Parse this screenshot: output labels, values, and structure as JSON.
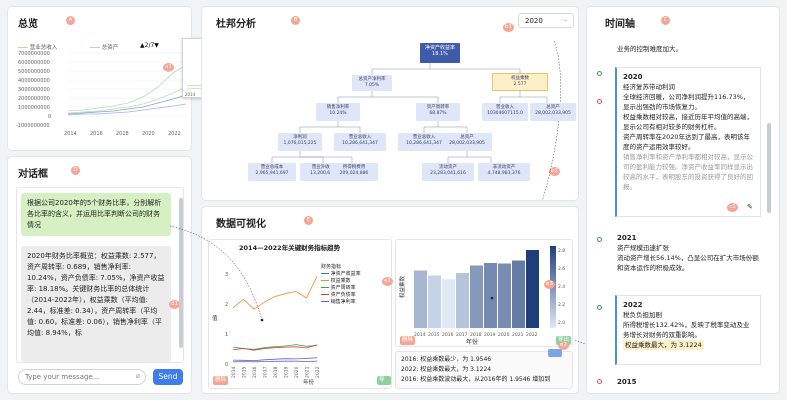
{
  "overview": {
    "title": "总览",
    "badge": "A",
    "legend": [
      "营业总收入",
      "总资产"
    ],
    "legend_pager": "2/7",
    "callout": "a1",
    "yticks": [
      "7000000000",
      "6000000000",
      "5000000000",
      "4000000000",
      "3000000000",
      "2000000000",
      "1000000000",
      "0",
      "-1000000000"
    ],
    "xticks": [
      "2014",
      "2016",
      "2018",
      "2020",
      "2022"
    ],
    "minimap_xticks": [
      "2014",
      "2016",
      "2018",
      "2020",
      "2022"
    ]
  },
  "chat": {
    "title": "对话框",
    "badge": "D",
    "user_message": "根据公司2020年的5个财务比率，分别解析各比率的含义，并运用比率判断公司的财务情况",
    "assistant_message": "2020年财务比率概览：权益乘数: 2.577，资产周转率: 0.689，销售净利率: 10.24%，资产负债率: 7.05%，净资产收益率: 18.18%。关键财务比率的总体统计（2014-2022年），权益乘数（平均值: 2.44，标准差: 0.34），资产周转率（平均值: 0.60，标准差: 0.06），销售净利率（平均值: 8.94%，标",
    "callout": "d1",
    "input_placeholder": "Type your message...",
    "send_label": "Send"
  },
  "dupont": {
    "title": "杜邦分析",
    "badge": "B",
    "year": "2020",
    "callouts": [
      "b1",
      "b2"
    ],
    "nodes": {
      "roe": {
        "label": "净资产收益率",
        "value": "18.1%"
      },
      "roa": {
        "label": "总资产净利率",
        "value": "7.05%"
      },
      "em": {
        "label": "权益乘数",
        "value": "2.577"
      },
      "assets": {
        "label": "总资产",
        "value": "3,077,012,500,000.00"
      },
      "margin": {
        "label": "销售净利率",
        "value": "10.24%"
      },
      "turnover": {
        "label": "资产周转率",
        "value": "68.87%"
      },
      "n1": {
        "label": "营业收入",
        "value": "10304607115.0"
      },
      "n2": {
        "label": "总资产",
        "value": "28,002,033,905"
      },
      "n3": {
        "label": "净利润",
        "value": "1,076,015,225"
      },
      "n4": {
        "label": "营业总收入",
        "value": "10,286,641,347"
      },
      "n5": {
        "label": "营业总收入",
        "value": "10,286,641,347"
      },
      "n6": {
        "label": "总资产",
        "value": "28,002,033,905"
      },
      "n7": {
        "label": "营业总成本",
        "value": "2,965,941,697"
      },
      "n8": {
        "label": "营业外收入",
        "value": "13,200,697"
      },
      "n9": {
        "label": "所得税费用",
        "value": "209,024,886"
      },
      "n10": {
        "label": "流动资产",
        "value": "23,283,041,616"
      },
      "n11": {
        "label": "非流动资产",
        "value": "4,748,983,376"
      }
    }
  },
  "viz": {
    "title": "数据可视化",
    "badge": "E",
    "chips": [
      "e1",
      "e2",
      "e3"
    ],
    "line_chart": {
      "title": "2014—2022年关键财务指标趋势",
      "xlabel": "年份",
      "ylabel": "值",
      "legend_title": "财务指标",
      "legend": [
        "净资产收益率",
        "权益乘数",
        "资产周转率",
        "资产负债率",
        "销售净利率"
      ],
      "legend_colors": [
        "#3d72c9",
        "#f28a2e",
        "#3a9f4c",
        "#d8403a",
        "#8458c1"
      ],
      "xticks": [
        "2014",
        "2015",
        "2016",
        "2017",
        "2018",
        "2019",
        "2020",
        "2021",
        "2022"
      ],
      "yticks": [
        "3",
        "2",
        "1",
        "0"
      ],
      "tags": [
        "删除",
        "导出"
      ]
    },
    "bar_chart": {
      "xlabel": "年份",
      "ylabel": "权益乘数",
      "xticks": [
        "2014",
        "2015",
        "2016",
        "2017",
        "2018",
        "2019",
        "2020",
        "2021",
        "2022"
      ],
      "colorbar_ticks": [
        "2.8",
        "2.6",
        "2.4",
        "2.2",
        "2.0"
      ],
      "tags": [
        "删除",
        "导出"
      ]
    },
    "insights": [
      "2016: 权益乘数最少，为 1.9546",
      "2022: 权益乘数最大，为 3.1224",
      "2016: 权益乘数波动最大，从2016年的 1.9546 增加到"
    ]
  },
  "chart_data": [
    {
      "type": "line",
      "title": "2014—2022年关键财务指标趋势",
      "xlabel": "年份",
      "ylabel": "值",
      "x": [
        2014,
        2015,
        2016,
        2017,
        2018,
        2019,
        2020,
        2021,
        2022
      ],
      "ylim": [
        0,
        3.2
      ],
      "series": [
        {
          "name": "净资产收益率",
          "values": [
            0.14,
            0.13,
            0.12,
            0.15,
            0.17,
            0.19,
            0.18,
            0.2,
            0.22
          ]
        },
        {
          "name": "权益乘数",
          "values": [
            2.0,
            2.3,
            1.95,
            2.2,
            2.4,
            2.5,
            2.58,
            2.35,
            3.12
          ]
        },
        {
          "name": "资产周转率",
          "values": [
            0.6,
            0.55,
            0.52,
            0.58,
            0.62,
            0.64,
            0.69,
            0.63,
            0.66
          ]
        },
        {
          "name": "资产负债率",
          "values": [
            0.5,
            0.56,
            0.49,
            0.55,
            0.58,
            0.6,
            0.61,
            0.57,
            0.68
          ]
        },
        {
          "name": "销售净利率",
          "values": [
            0.08,
            0.085,
            0.08,
            0.09,
            0.095,
            0.1,
            0.1,
            0.09,
            0.1
          ]
        }
      ]
    },
    {
      "type": "bar",
      "xlabel": "年份",
      "ylabel": "权益乘数",
      "categories": [
        "2014",
        "2015",
        "2016",
        "2017",
        "2018",
        "2019",
        "2020",
        "2021",
        "2022"
      ],
      "values": [
        2.3,
        2.1,
        1.95,
        2.2,
        2.5,
        2.6,
        2.58,
        2.7,
        3.12
      ],
      "colorbar_range": [
        1.95,
        3.12
      ]
    }
  ],
  "timeline": {
    "title": "时间轴",
    "badge": "C",
    "intro": "业务的控制难度加大。",
    "callout": "c1",
    "entries": [
      {
        "year": "2020",
        "heading": "经济复苏带动利润",
        "lines": [
          "全球经济回暖，公司净利润提升116.73%，显示出强劲的市场恢复力。",
          "权益乘数相对较高，接近历年平均值的高端，显示公司有相对较多的财务杠杆。",
          "资产周转率在2020年达到了最高，表明该年度的资产运用效率较好。",
          "销售净利率和资产净利率都相对较高，显示公司的盈利能力较强。净资产收益率同样显示出较高的水平，表明股东的投资获得了良好的回报。"
        ]
      },
      {
        "year": "2021",
        "heading": "资产规模迅速扩张",
        "lines": [
          "流动资产增长56.14%，凸显公司在扩大市场份额和资本运作的积极成效。"
        ]
      },
      {
        "year": "2022",
        "heading": "税负负担加剧",
        "lines": [
          "所得税增长132.42%，反映了税率变动及业务增长对财务的双重影响。"
        ],
        "highlight": "权益乘数最大，为 3.1224"
      },
      {
        "year": "2015",
        "heading": "",
        "lines": []
      }
    ]
  }
}
